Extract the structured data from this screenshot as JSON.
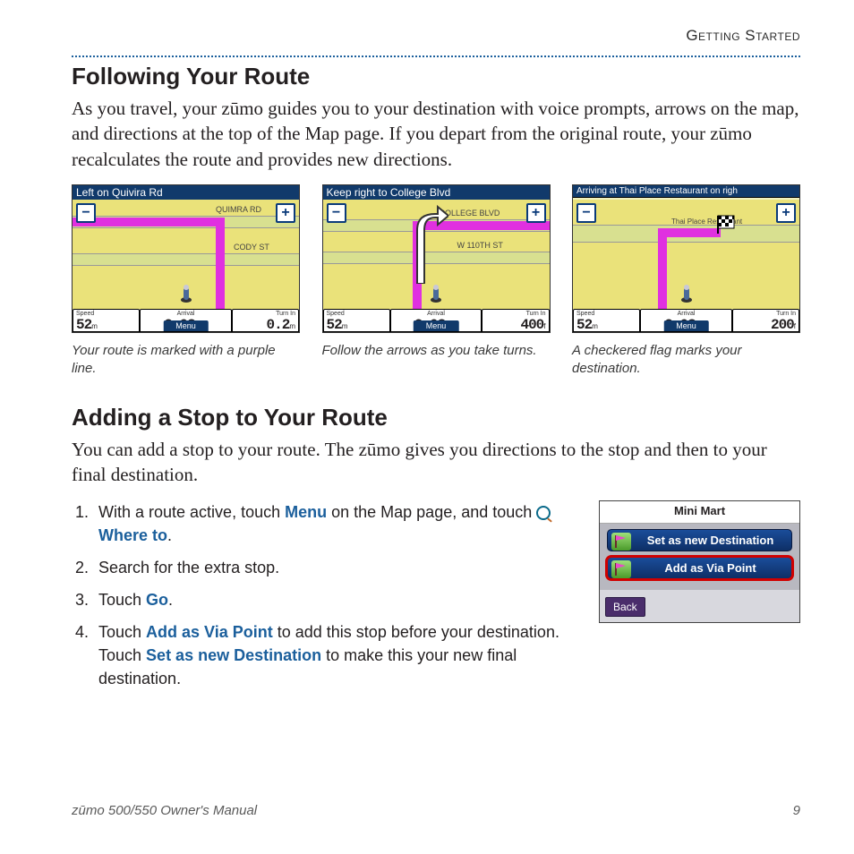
{
  "header": {
    "section": "Getting Started"
  },
  "sec1": {
    "title": "Following Your Route",
    "body": "As you travel, your zūmo guides you to your destination with voice prompts, arrows on the map, and directions at the top of the Map page. If you depart from the original route, your zūmo recalculates the route and provides new directions."
  },
  "shots": [
    {
      "title": "Left on Quivira Rd",
      "roads": [
        "QUIMRA RD",
        "CODY ST"
      ],
      "status": {
        "speed_label": "Speed",
        "speed": "52",
        "speed_unit": "m",
        "arrival_label": "Arrival",
        "arrival": "2:03",
        "arrival_unit": "P M",
        "turn_label": "Turn In",
        "turn": "0.2",
        "turn_unit": "m",
        "menu": "Menu"
      },
      "caption": "Your route is marked with a purple line."
    },
    {
      "title": "Keep right to College Blvd",
      "roads": [
        "COLLEGE BLVD",
        "W 110TH ST"
      ],
      "status": {
        "speed_label": "Speed",
        "speed": "52",
        "speed_unit": "m",
        "arrival_label": "Arrival",
        "arrival": "2:03",
        "arrival_unit": "P M",
        "turn_label": "Turn In",
        "turn": "400",
        "turn_unit": "f",
        "menu": "Menu"
      },
      "caption": "Follow the arrows as you take turns."
    },
    {
      "title": "Arriving at Thai Place Restaurant on righ",
      "roads": [
        "Thai Place Restaurant"
      ],
      "status": {
        "speed_label": "Speed",
        "speed": "52",
        "speed_unit": "m",
        "arrival_label": "Arrival",
        "arrival": "2:03",
        "arrival_unit": "P M",
        "turn_label": "Turn In",
        "turn": "200",
        "turn_unit": "f",
        "menu": "Menu"
      },
      "caption": "A checkered flag marks your destination."
    }
  ],
  "zoom": {
    "minus": "−",
    "plus": "+"
  },
  "sec2": {
    "title": "Adding a Stop to Your Route",
    "body": "You can add a stop to your route. The zūmo gives you directions to the stop and then to your final destination."
  },
  "steps": {
    "s1a": "With a route active, touch ",
    "s1_menu": "Menu",
    "s1b": " on the Map page, and touch ",
    "s1_where": "Where to",
    "s1c": ".",
    "s2": "Search for the extra stop.",
    "s3a": "Touch ",
    "s3_go": "Go",
    "s3b": ".",
    "s4a": "Touch ",
    "s4_via": "Add as Via Point",
    "s4b": " to add this stop before your destination. Touch ",
    "s4_dest": "Set as new Destination",
    "s4c": " to make this your new final destination."
  },
  "popup": {
    "title": "Mini Mart",
    "btn1": "Set as new Destination",
    "btn2": "Add as Via Point",
    "back": "Back"
  },
  "footer": {
    "left": "zūmo 500/550 Owner's Manual",
    "right": "9"
  }
}
